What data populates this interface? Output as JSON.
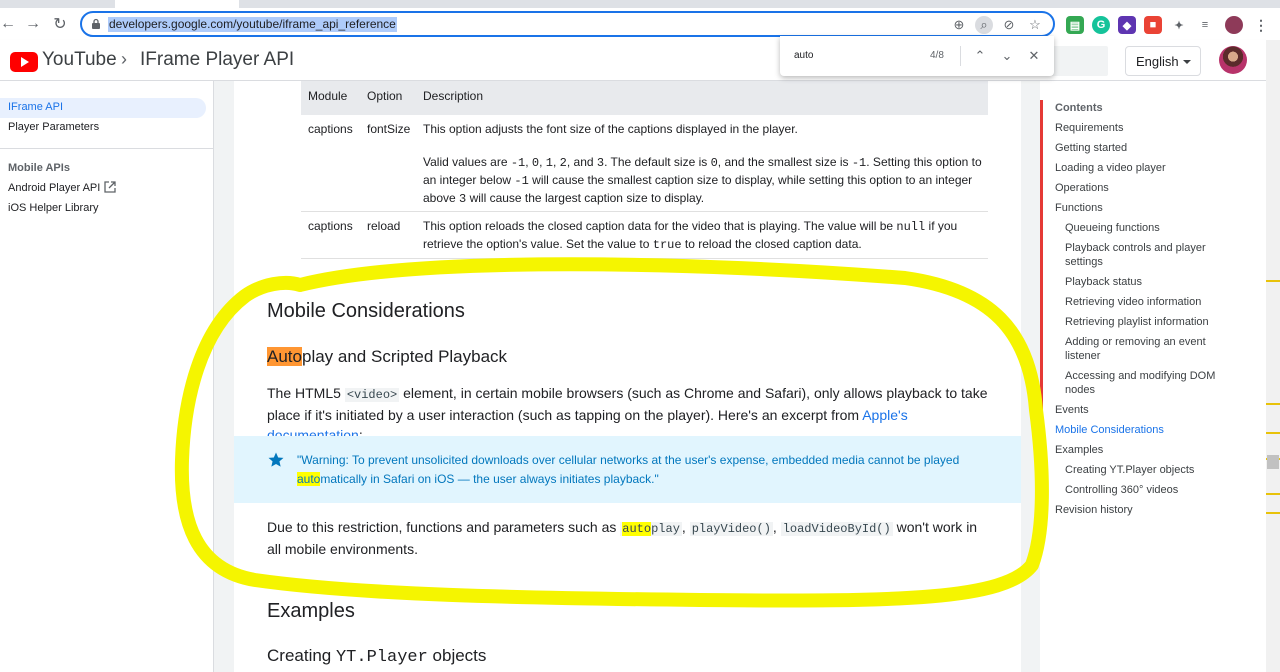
{
  "browser": {
    "url": "developers.google.com/youtube/iframe_api_reference",
    "find": {
      "query": "auto",
      "count": "4/8"
    }
  },
  "header": {
    "brand": "YouTube",
    "separator": "›",
    "title": "IFrame Player API",
    "language": "English"
  },
  "left_nav": {
    "items": [
      "IFrame API",
      "Player Parameters"
    ],
    "section_title": "Mobile APIs",
    "mobile_items": [
      "Android Player API",
      "iOS Helper Library"
    ]
  },
  "table": {
    "headers": [
      "Module",
      "Option",
      "Description"
    ],
    "rows": [
      {
        "module": "captions",
        "option": "fontSize",
        "desc1": "This option adjusts the font size of the captions displayed in the player.",
        "desc2_a": "Valid values are ",
        "desc2_vals": [
          "-1",
          "0",
          "1",
          "2",
          "3"
        ],
        "desc2_b": ". The default size is ",
        "default_val": "0",
        "desc2_c": ", and the smallest size is ",
        "smallest_val": "-1",
        "desc2_d": ". Setting this option to an integer below ",
        "below_val": "-1",
        "desc2_e": " will cause the smallest caption size to display, while setting this option to an integer above ",
        "above_val": "3",
        "desc2_f": " will cause the largest caption size to display."
      },
      {
        "module": "captions",
        "option": "reload",
        "desc_a": "This option reloads the closed caption data for the video that is playing. The value will be ",
        "null_val": "null",
        "desc_b": " if you retrieve the option's value. Set the value to ",
        "true_val": "true",
        "desc_c": " to reload the closed caption data."
      }
    ]
  },
  "content": {
    "h_mobile": "Mobile Considerations",
    "h_autoplay_hl": "Auto",
    "h_autoplay_rest": "play and Scripted Playback",
    "p1_a": "The HTML5 ",
    "p1_code": "<video>",
    "p1_b": " element, in certain mobile browsers (such as Chrome and Safari), only allows playback to take place if it's initiated by a user interaction (such as tapping on the player). Here's an excerpt from ",
    "p1_link": "Apple's documentation",
    "p1_c": ":",
    "callout_a": "\"Warning: To prevent unsolicited downloads over cellular networks at the user's expense, embedded media cannot be played ",
    "callout_hl": "auto",
    "callout_b": "matically in Safari on iOS — the user always initiates playback.\"",
    "p2_a": "Due to this restriction, functions and parameters such as ",
    "p2_code1_hl": "auto",
    "p2_code1_rest": "play",
    "p2_code2": "playVideo()",
    "p2_code3": "loadVideoById()",
    "p2_b": " won't work in all mobile environments.",
    "h_examples": "Examples",
    "h_creating_a": "Creating ",
    "h_creating_code": "YT.Player",
    "h_creating_b": " objects"
  },
  "toc": {
    "title": "Contents",
    "items": [
      "Requirements",
      "Getting started",
      "Loading a video player",
      "Operations",
      "Functions",
      "Queueing functions",
      "Playback controls and player settings",
      "Playback status",
      "Retrieving video information",
      "Retrieving playlist information",
      "Adding or removing an event listener",
      "Accessing and modifying DOM nodes",
      "Events",
      "Mobile Considerations",
      "Examples",
      "Creating YT.Player objects",
      "Controlling 360° videos",
      "Revision history"
    ]
  },
  "colors": {
    "accent": "#1a73e8",
    "find_current": "#ff9632",
    "find_match": "#ffff00",
    "annotation": "#f5f500",
    "toc_bar": "#e53935",
    "callout_bg": "#e1f5fe"
  },
  "icons": [
    "back-icon",
    "forward-icon",
    "reload-icon",
    "lock-icon",
    "star-icon",
    "youtube-logo",
    "external-link-icon",
    "chevron-up-icon",
    "chevron-down-icon",
    "close-icon",
    "menu-icon"
  ]
}
